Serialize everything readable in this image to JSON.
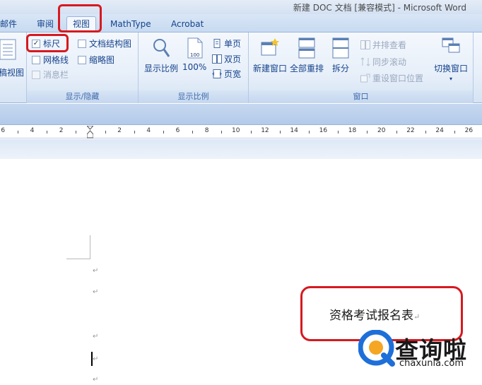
{
  "window": {
    "title": "新建 DOC 文档 [兼容模式] - Microsoft Word"
  },
  "tabs": [
    {
      "label": "邮件"
    },
    {
      "label": "审阅"
    },
    {
      "label": "视图",
      "active": true
    },
    {
      "label": "MathType"
    },
    {
      "label": "Acrobat"
    }
  ],
  "ribbon": {
    "partial_view_label": "草稿视图",
    "show_hide": {
      "label": "显示/隐藏",
      "ruler": {
        "label": "标尺",
        "checked": true
      },
      "gridlines": {
        "label": "网格线",
        "checked": false
      },
      "message_bar": {
        "label": "消息栏",
        "checked": false,
        "disabled": true
      },
      "doc_map": {
        "label": "文档结构图",
        "checked": false
      },
      "thumbnails": {
        "label": "缩略图",
        "checked": false
      }
    },
    "zoom": {
      "label": "显示比例",
      "zoom_button": "显示比例",
      "hundred_percent": "100%",
      "one_page": "单页",
      "two_pages": "双页",
      "page_width": "页宽",
      "icon_badge": "100"
    },
    "window": {
      "label": "窗口",
      "new_window": "新建窗口",
      "arrange_all": "全部重排",
      "split": "拆分",
      "side_by_side": "并排查看",
      "sync_scroll": "同步滚动",
      "reset_position": "重设窗口位置",
      "switch_windows": "切换窗口"
    }
  },
  "ruler": {
    "labels": [
      "6",
      "4",
      "2",
      "2",
      "4",
      "6",
      "8",
      "10",
      "12",
      "14",
      "16",
      "18",
      "20",
      "22",
      "24",
      "26"
    ]
  },
  "document": {
    "text": "资格考试报名表",
    "paragraph_mark": "↵"
  },
  "watermark": {
    "name": "查询啦",
    "url": "chaxunla.com"
  },
  "colors": {
    "highlight": "#d71920",
    "ribbon_text": "#15428b",
    "watermark_blue": "#1e6fd9"
  }
}
